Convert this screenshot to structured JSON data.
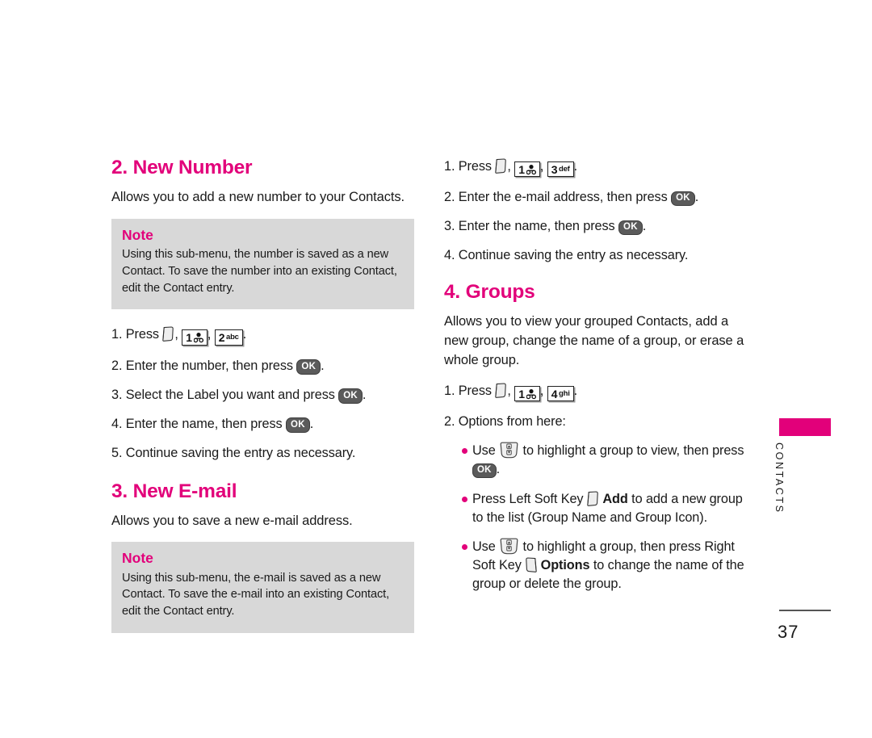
{
  "page": {
    "number": "37",
    "side_tab": "CONTACTS"
  },
  "left_column": {
    "section_new_number": {
      "heading": "2. New Number",
      "intro": "Allows you to add a new number to your Contacts.",
      "note": {
        "title": "Note",
        "body": "Using this sub-menu, the number is saved as a new Contact. To save the number into an existing Contact, edit the Contact entry."
      },
      "steps": {
        "s1_num": "1. Press",
        "s1_sep1": ",",
        "s1_sep2": ",",
        "s1_end": ".",
        "s2": "2. Enter the number, then press",
        "s2_end": ".",
        "s3": "3. Select the Label you want and press",
        "s3_end": ".",
        "s4": "4. Enter the name, then press",
        "s4_end": ".",
        "s5": "5. Continue saving the entry as necessary."
      },
      "keys": {
        "key1_digit": "1",
        "key2_digit": "2",
        "key2_sub": "abc"
      }
    },
    "section_new_email": {
      "heading": "3. New E-mail",
      "intro": "Allows you to save a new e-mail address.",
      "note": {
        "title": "Note",
        "body": "Using this sub-menu, the e-mail is saved as a new Contact. To save the e-mail into an existing Contact, edit the Contact entry."
      }
    }
  },
  "right_column": {
    "email_steps": {
      "s1_num": "1. Press",
      "s1_sep1": ",",
      "s1_sep2": ",",
      "s1_end": ".",
      "s2": "2. Enter the e-mail address, then press",
      "s2_end": ".",
      "s3": "3. Enter the name, then press",
      "s3_end": ".",
      "s4": "4. Continue saving the entry as necessary.",
      "keys": {
        "key1_digit": "1",
        "key3_digit": "3",
        "key3_sub": "def"
      }
    },
    "section_groups": {
      "heading": "4. Groups",
      "intro": "Allows you to view your grouped Contacts, add a new group, change the name of a group, or erase a whole group.",
      "steps": {
        "s1_num": "1. Press",
        "s1_sep1": ",",
        "s1_sep2": ",",
        "s1_end": ".",
        "s2": "2. Options from here:"
      },
      "keys": {
        "key1_digit": "1",
        "key4_digit": "4",
        "key4_sub": "ghi"
      },
      "bullets": {
        "b1_pre": "Use",
        "b1_mid": "to highlight a group to view, then press",
        "b1_end": ".",
        "b2_pre": "Press Left Soft Key",
        "b2_bold": "Add",
        "b2_post": "to add a new group to the list (Group Name and Group Icon).",
        "b3_pre": "Use",
        "b3_mid": "to highlight a group, then press Right Soft Key",
        "b3_bold": "Options",
        "b3_post": "to change the name of the group or delete the group."
      }
    }
  },
  "ok_label": "OK",
  "colors": {
    "accent": "#e2007a",
    "note_bg": "#d8d8d8",
    "ok_key_bg": "#5b5b5b",
    "text": "#1a1a1a"
  }
}
